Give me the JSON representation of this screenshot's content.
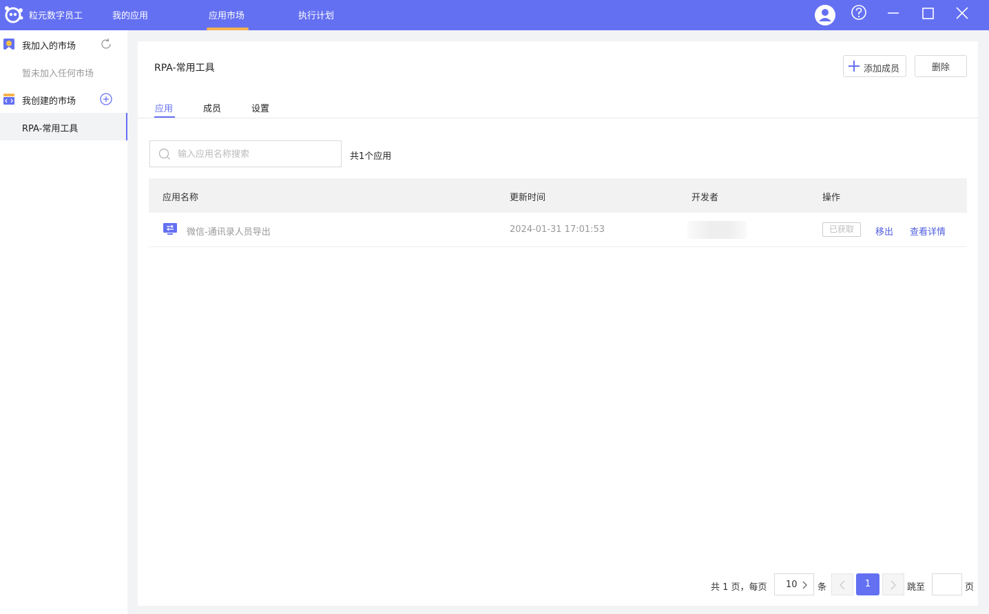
{
  "app": {
    "brand": "粒元数字员工"
  },
  "nav": {
    "items": [
      "我的应用",
      "应用市场",
      "执行计划"
    ],
    "active": "应用市场"
  },
  "sidebar": {
    "joined_label": "我加入的市场",
    "joined_empty": "暂未加入任何市场",
    "created_label": "我创建的市场",
    "created_items": [
      "RPA-常用工具"
    ]
  },
  "market": {
    "title": "RPA-常用工具",
    "add_member_label": "添加成员",
    "delete_label": "删除",
    "tabs": [
      "应用",
      "成员",
      "设置"
    ],
    "active_tab": "应用"
  },
  "search": {
    "placeholder": "输入应用名称搜索"
  },
  "summary": {
    "count_text": "共1个应用"
  },
  "table": {
    "columns": [
      "应用名称",
      "更新时间",
      "开发者",
      "操作"
    ],
    "rows": [
      {
        "name": "微信-通讯录人员导出",
        "updated": "2024-01-31 17:01:53",
        "developer": "",
        "status_tag": "已获取",
        "actions": [
          "移出",
          "查看详情"
        ]
      }
    ]
  },
  "pagination": {
    "total_prefix": "共 1 页，每页",
    "page_size": "10",
    "unit": "条",
    "current_page": "1",
    "jump_label": "跳至",
    "page_suffix": "页"
  },
  "colors": {
    "accent": "#6470f2",
    "tab_indicator": "#f6b24e",
    "link": "#4f5de0"
  }
}
